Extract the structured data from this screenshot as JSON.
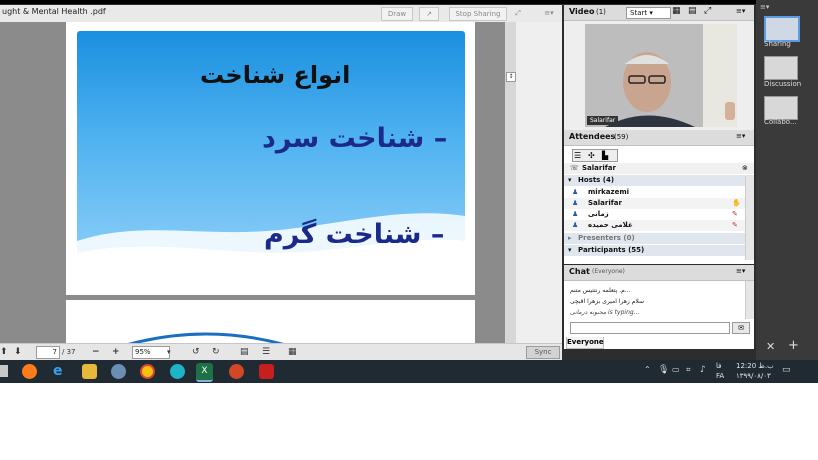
{
  "pdf": {
    "filename": "ught & Mental Health .pdf",
    "draw_label": "Draw",
    "stop_sharing_label": "Stop Sharing",
    "page_number": "7",
    "page_total": "/ 37",
    "zoom": "95%",
    "sync_label": "Sync"
  },
  "slide": {
    "title": "انواع شناخت",
    "bullet1": "– شناخت سرد",
    "bullet2": "– شناخت گرم"
  },
  "video": {
    "label": "Video",
    "count": "(1)",
    "start_label": "Start",
    "presenter_name": "Salarifar"
  },
  "attendees": {
    "label": "Attendees",
    "count": "(59)",
    "self_name": "Salarifar",
    "hosts_label": "Hosts (4)",
    "hosts": [
      "mirkazemi",
      "Salarifar",
      "زمانی",
      "غلامی حمیده"
    ],
    "presenters_label": "Presenters (0)",
    "participants_label": "Participants (55)"
  },
  "chat": {
    "label": "Chat",
    "scope": "(Everyone)",
    "messages": [
      "...م. پتعلمه رنتتیس متنم",
      "سلام زهرا امیری بزهرا اقبچی"
    ],
    "typing": "محبوبه درمانی is typing...",
    "tab": "Everyone"
  },
  "sidebar": {
    "items": [
      "Sharing",
      "Discussion",
      "Collabo..."
    ]
  },
  "taskbar": {
    "time": "12:20 ب.ظ",
    "date": "۱۳۹۹/۰۸/۰۳",
    "lang": "FA"
  },
  "colors": {
    "slide_top": "#1a8fe0",
    "slide_bottom": "#8fd0f8",
    "taskbar": "#1f2a33",
    "sidebar": "#3a3a3a"
  }
}
